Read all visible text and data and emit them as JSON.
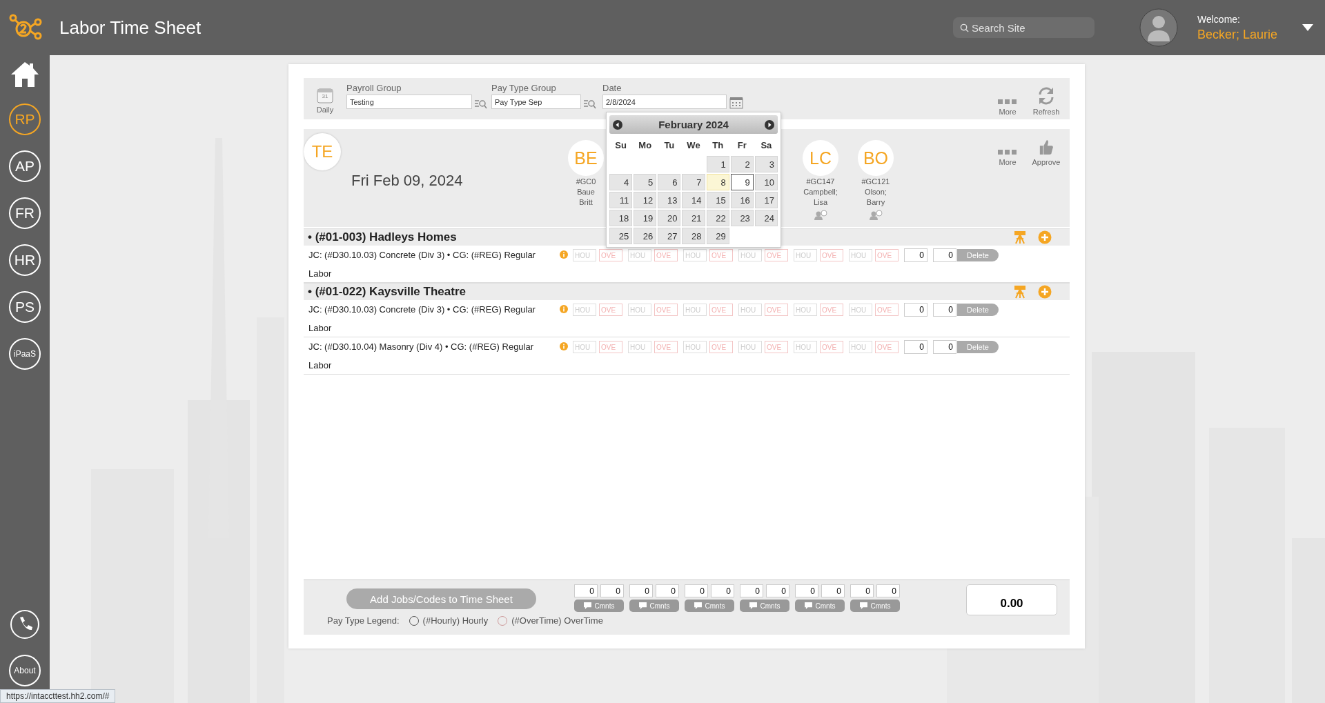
{
  "header": {
    "title": "Labor Time Sheet",
    "search": {
      "placeholder": "Search Site"
    },
    "welcome": "Welcome:",
    "user": "Becker; Laurie"
  },
  "sidebar": {
    "items": [
      {
        "kind": "home",
        "selected": false
      },
      {
        "kind": "text",
        "label": "RP",
        "selected": true
      },
      {
        "kind": "text",
        "label": "AP",
        "selected": false
      },
      {
        "kind": "text",
        "label": "FR",
        "selected": false
      },
      {
        "kind": "text",
        "label": "HR",
        "selected": false
      },
      {
        "kind": "text",
        "label": "PS",
        "selected": false
      },
      {
        "kind": "text",
        "label": "iPaaS",
        "selected": false
      }
    ],
    "bottom": [
      {
        "kind": "phone"
      },
      {
        "kind": "text",
        "label": "About"
      }
    ]
  },
  "toolbar": {
    "daily": {
      "icon_day": "31",
      "label": "Daily"
    },
    "payroll_group": {
      "label": "Payroll Group",
      "value": "Testing"
    },
    "pay_type_group": {
      "label": "Pay Type Group",
      "value": "Pay Type Sep"
    },
    "date": {
      "label": "Date",
      "value": "2/8/2024"
    },
    "actions": [
      {
        "kind": "more",
        "label": "More"
      },
      {
        "kind": "refresh",
        "label": "Refresh"
      }
    ]
  },
  "calendar": {
    "month": "February 2024",
    "weekdays": [
      "Su",
      "Mo",
      "Tu",
      "We",
      "Th",
      "Fr",
      "Sa"
    ],
    "weeks": [
      [
        {
          "label": "1",
          "selected": false,
          "today": false
        },
        {
          "label": "2",
          "selected": false,
          "today": false
        },
        {
          "label": "3",
          "selected": false,
          "today": false
        }
      ],
      [
        {
          "label": "4",
          "selected": false,
          "today": false
        },
        {
          "label": "5",
          "selected": false,
          "today": false
        },
        {
          "label": "6",
          "selected": false,
          "today": false
        },
        {
          "label": "7",
          "selected": false,
          "today": false
        },
        {
          "label": "8",
          "selected": true,
          "today": false
        },
        {
          "label": "9",
          "selected": false,
          "today": true
        },
        {
          "label": "10",
          "selected": false,
          "today": false
        }
      ],
      [
        {
          "label": "11",
          "selected": false,
          "today": false
        },
        {
          "label": "12",
          "selected": false,
          "today": false
        },
        {
          "label": "13",
          "selected": false,
          "today": false
        },
        {
          "label": "14",
          "selected": false,
          "today": false
        },
        {
          "label": "15",
          "selected": false,
          "today": false
        },
        {
          "label": "16",
          "selected": false,
          "today": false
        },
        {
          "label": "17",
          "selected": false,
          "today": false
        }
      ],
      [
        {
          "label": "18",
          "selected": false,
          "today": false
        },
        {
          "label": "19",
          "selected": false,
          "today": false
        },
        {
          "label": "20",
          "selected": false,
          "today": false
        },
        {
          "label": "21",
          "selected": false,
          "today": false
        },
        {
          "label": "22",
          "selected": false,
          "today": false
        },
        {
          "label": "23",
          "selected": false,
          "today": false
        },
        {
          "label": "24",
          "selected": false,
          "today": false
        }
      ],
      [
        {
          "label": "25",
          "selected": false,
          "today": false
        },
        {
          "label": "26",
          "selected": false,
          "today": false
        },
        {
          "label": "27",
          "selected": false,
          "today": false
        },
        {
          "label": "28",
          "selected": false,
          "today": false
        },
        {
          "label": "29",
          "selected": false,
          "today": false
        }
      ]
    ]
  },
  "day": {
    "initials": "TE",
    "date": "Fri Feb 09, 2024",
    "employees": [
      {
        "initials": "BE",
        "code": "#GC0",
        "name": "Baue Britt"
      },
      {
        "initials": "LC",
        "code": "#GC147",
        "name": "Campbell; Lisa"
      },
      {
        "initials": "BO",
        "code": "#GC121",
        "name": "Olson; Barry"
      }
    ],
    "actions": [
      {
        "kind": "more",
        "label": "More"
      },
      {
        "kind": "approve",
        "label": "Approve"
      }
    ]
  },
  "groups": [
    {
      "title": "• (#01-003) Hadleys Homes",
      "lines": [
        {
          "text": "JC: (#D30.10.03) Concrete (Div 3) • CG: (#REG) Regular Labor",
          "days": [
            {
              "hours": {
                "placeholder": "HOU"
              },
              "overtime": {
                "placeholder": "OVE"
              }
            },
            {
              "hours": {
                "placeholder": "HOU"
              },
              "overtime": {
                "placeholder": "OVE"
              }
            },
            {
              "hours": {
                "placeholder": "HOU"
              },
              "overtime": {
                "placeholder": "OVE"
              }
            },
            {
              "hours": {
                "placeholder": "HOU"
              },
              "overtime": {
                "placeholder": "OVE"
              }
            },
            {
              "hours": {
                "placeholder": "HOU"
              },
              "overtime": {
                "placeholder": "OVE"
              }
            },
            {
              "hours": {
                "placeholder": "HOU"
              },
              "overtime": {
                "placeholder": "OVE"
              }
            }
          ],
          "totals": [
            "0",
            "0"
          ],
          "delete": "Delete"
        }
      ]
    },
    {
      "title": "• (#01-022) Kaysville Theatre",
      "lines": [
        {
          "text": "JC: (#D30.10.03) Concrete (Div 3) • CG: (#REG) Regular Labor",
          "days": [
            {
              "hours": {
                "placeholder": "HOU"
              },
              "overtime": {
                "placeholder": "OVE"
              }
            },
            {
              "hours": {
                "placeholder": "HOU"
              },
              "overtime": {
                "placeholder": "OVE"
              }
            },
            {
              "hours": {
                "placeholder": "HOU"
              },
              "overtime": {
                "placeholder": "OVE"
              }
            },
            {
              "hours": {
                "placeholder": "HOU"
              },
              "overtime": {
                "placeholder": "OVE"
              }
            },
            {
              "hours": {
                "placeholder": "HOU"
              },
              "overtime": {
                "placeholder": "OVE"
              }
            },
            {
              "hours": {
                "placeholder": "HOU"
              },
              "overtime": {
                "placeholder": "OVE"
              }
            }
          ],
          "totals": [
            "0",
            "0"
          ],
          "delete": "Delete"
        },
        {
          "text": "JC: (#D30.10.04) Masonry (Div 4) • CG: (#REG) Regular Labor",
          "days": [
            {
              "hours": {
                "placeholder": "HOU"
              },
              "overtime": {
                "placeholder": "OVE"
              }
            },
            {
              "hours": {
                "placeholder": "HOU"
              },
              "overtime": {
                "placeholder": "OVE"
              }
            },
            {
              "hours": {
                "placeholder": "HOU"
              },
              "overtime": {
                "placeholder": "OVE"
              }
            },
            {
              "hours": {
                "placeholder": "HOU"
              },
              "overtime": {
                "placeholder": "OVE"
              }
            },
            {
              "hours": {
                "placeholder": "HOU"
              },
              "overtime": {
                "placeholder": "OVE"
              }
            },
            {
              "hours": {
                "placeholder": "HOU"
              },
              "overtime": {
                "placeholder": "OVE"
              }
            }
          ],
          "totals": [
            "0",
            "0"
          ],
          "delete": "Delete"
        }
      ]
    }
  ],
  "footer": {
    "add_button": "Add Jobs/Codes to Time Sheet",
    "day_totals": [
      {
        "hours": "0",
        "overtime": "0",
        "comments": "Cmnts"
      },
      {
        "hours": "0",
        "overtime": "0",
        "comments": "Cmnts"
      },
      {
        "hours": "0",
        "overtime": "0",
        "comments": "Cmnts"
      },
      {
        "hours": "0",
        "overtime": "0",
        "comments": "Cmnts"
      },
      {
        "hours": "0",
        "overtime": "0",
        "comments": "Cmnts"
      },
      {
        "hours": "0",
        "overtime": "0",
        "comments": "Cmnts"
      }
    ],
    "grand_total": "0.00",
    "legend": {
      "label": "Pay Type Legend:",
      "items": [
        {
          "kind": "hours",
          "label": "(#Hourly) Hourly"
        },
        {
          "kind": "overtime",
          "label": "(#OverTime) OverTime"
        }
      ]
    }
  },
  "status_url": "https://intaccttest.hh2.com/#"
}
